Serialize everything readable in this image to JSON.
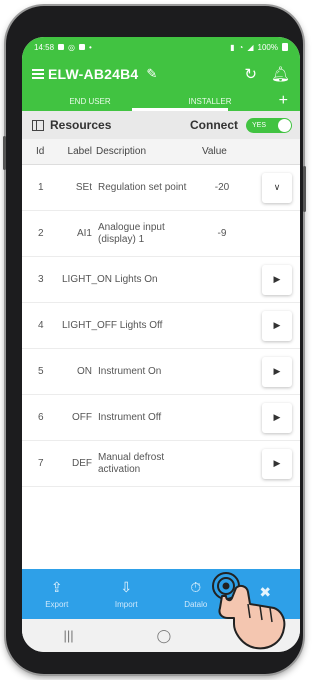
{
  "status_bar": {
    "time": "14:58",
    "battery": "100%"
  },
  "app_bar": {
    "title": "ELW-AB24B4"
  },
  "tabs": [
    {
      "label": "END USER"
    },
    {
      "label": "INSTALLER"
    }
  ],
  "resources": {
    "label": "Resources",
    "connect_label": "Connect",
    "toggle_state": "YES"
  },
  "table": {
    "headers": {
      "id": "Id",
      "label": "Label",
      "description": "Description",
      "value": "Value"
    },
    "rows": [
      {
        "id": "1",
        "label": "SEt",
        "description": "Regulation set point",
        "value": "-20",
        "action": "expand"
      },
      {
        "id": "2",
        "label": "AI1",
        "description": "Analogue input (display) 1",
        "value": "-9",
        "action": ""
      },
      {
        "id": "3",
        "combined": "LIGHT_ON Lights On",
        "action": "run"
      },
      {
        "id": "4",
        "combined": "LIGHT_OFF Lights Off",
        "action": "run"
      },
      {
        "id": "5",
        "label": "ON",
        "description": "Instrument On",
        "value": "",
        "action": "run"
      },
      {
        "id": "6",
        "label": "OFF",
        "description": "Instrument Off",
        "value": "",
        "action": "run"
      },
      {
        "id": "7",
        "label": "DEF",
        "description": "Manual defrost activation",
        "value": "",
        "action": "run"
      }
    ]
  },
  "bottom_nav": [
    {
      "label": "Export",
      "icon": "export-icon"
    },
    {
      "label": "Import",
      "icon": "import-icon"
    },
    {
      "label": "Datalo",
      "icon": "datalog-icon"
    },
    {
      "label": "",
      "icon": "tools-icon"
    }
  ],
  "colors": {
    "primary": "#41c341",
    "bottom_nav": "#2ea0e8"
  }
}
